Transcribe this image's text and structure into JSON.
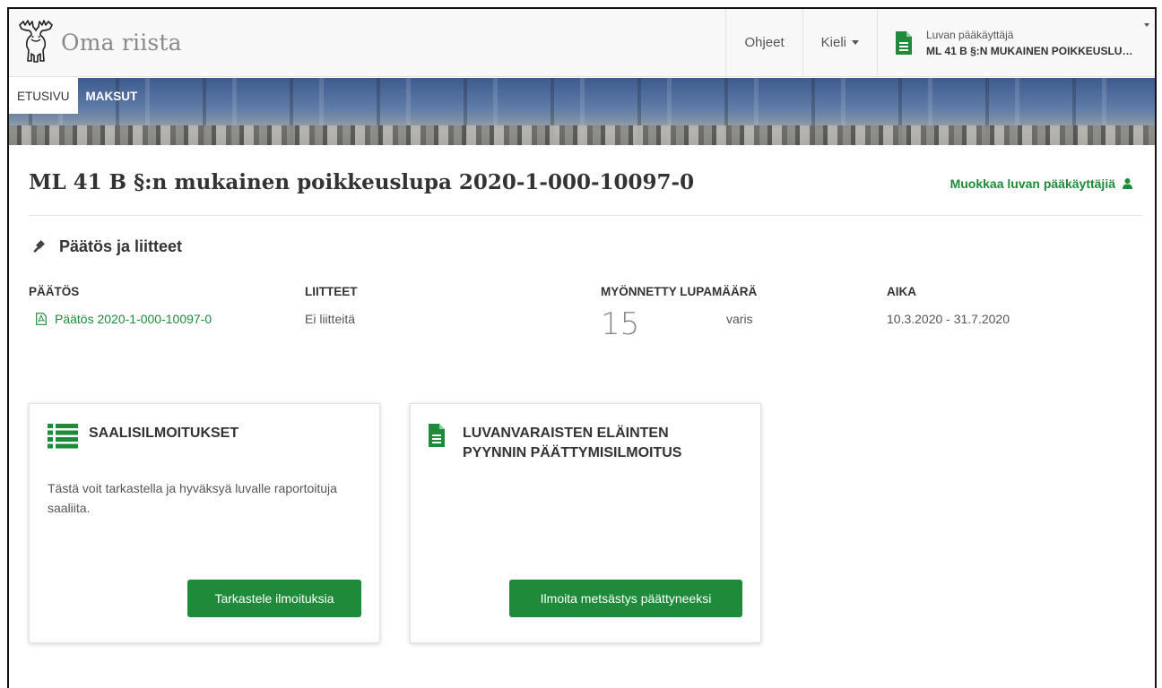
{
  "app": {
    "brand": "Oma riista"
  },
  "nav": {
    "help": "Ohjeet",
    "language": "Kieli",
    "user_role": "Luvan pääkäyttäjä",
    "user_name": "ML 41 B §:N MUKAINEN POIKKEUSLU…"
  },
  "tabs": [
    {
      "label": "ETUSIVU",
      "active": true
    },
    {
      "label": "MAKSUT",
      "active": false
    }
  ],
  "page": {
    "title": "ML 41 B §:n mukainen poikkeuslupa 2020-1-000-10097-0",
    "edit_link": "Muokkaa luvan pääkäyttäjiä"
  },
  "decision_section": {
    "title": "Päätös ja liitteet",
    "headers": {
      "decision": "PÄÄTÖS",
      "attachments": "LIITTEET",
      "granted_amount": "MYÖNNETTY LUPAMÄÄRÄ",
      "time": "AIKA"
    },
    "decision_link": "Päätös 2020-1-000-10097-0",
    "attachments_value": "Ei liitteitä",
    "amount": "15",
    "species": "varis",
    "period": "10.3.2020 - 31.7.2020"
  },
  "cards": {
    "harvest": {
      "title": "SAALISILMOITUKSET",
      "body": "Tästä voit tarkastella ja hyväksyä luvalle raportoituja saaliita.",
      "button": "Tarkastele ilmoituksia",
      "icon": "list-icon"
    },
    "end_notice": {
      "title_line1": "LUVANVARAISTEN ELÄINTEN",
      "title_line2": "PYYNNIN PÄÄTTYMISILMOITUS",
      "button": "Ilmoita metsästys päättyneeksi",
      "icon": "document-icon"
    }
  },
  "colors": {
    "accent": "#1e8a3a",
    "text": "#333333",
    "muted": "#555555"
  }
}
